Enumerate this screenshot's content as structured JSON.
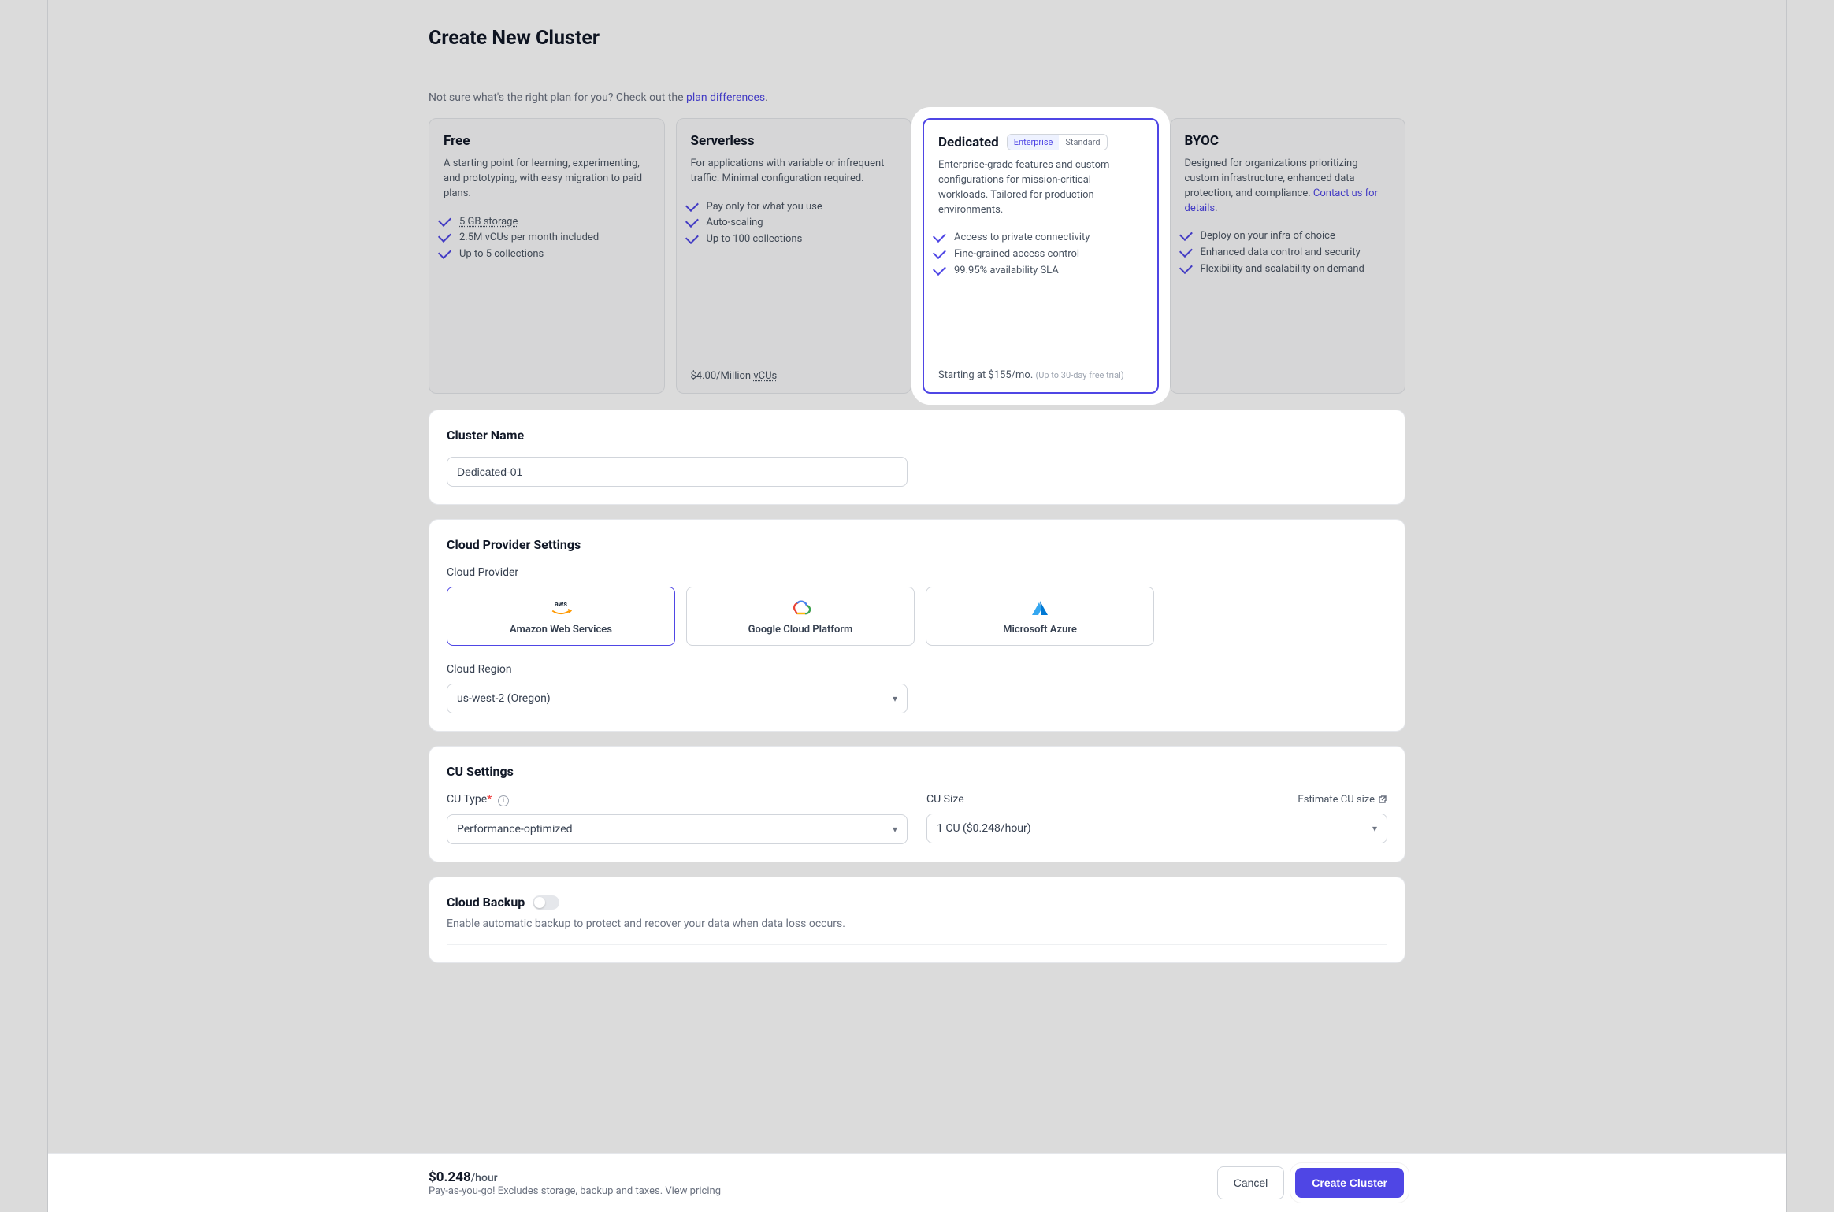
{
  "page": {
    "title": "Create New Cluster",
    "subhead_prefix": "Not sure what's the right plan for you? Check out the ",
    "subhead_link": "plan differences",
    "subhead_suffix": "."
  },
  "plans": {
    "free": {
      "title": "Free",
      "desc": "A starting point for learning, experimenting, and prototyping, with easy migration to paid plans.",
      "bullets": [
        "5 GB storage",
        "2.5M vCUs per month included",
        "Up to 5 collections"
      ],
      "price": ""
    },
    "serverless": {
      "title": "Serverless",
      "desc": "For applications with variable or infrequent traffic. Minimal configuration required.",
      "bullets": [
        "Pay only for what you use",
        "Auto-scaling",
        "Up to 100 collections"
      ],
      "price": "$4.00/Million vCUs"
    },
    "dedicated": {
      "title": "Dedicated",
      "toggle_enterprise": "Enterprise",
      "toggle_standard": "Standard",
      "desc": "Enterprise-grade features and custom configurations for mission-critical workloads. Tailored for production environments.",
      "bullets": [
        "Access to private connectivity",
        "Fine-grained access control",
        "99.95% availability SLA"
      ],
      "price_main": "Starting at $155/mo. ",
      "price_note": "(Up to 30-day free trial)"
    },
    "byoc": {
      "title": "BYOC",
      "desc_prefix": "Designed for organizations prioritizing custom infrastructure, enhanced data protection, and compliance. ",
      "desc_link": "Contact us for details",
      "desc_suffix": ".",
      "bullets": [
        "Deploy on your infra of choice",
        "Enhanced data control and security",
        "Flexibility and scalability on demand"
      ]
    }
  },
  "cluster_name": {
    "label": "Cluster Name",
    "value": "Dedicated-01"
  },
  "cloud": {
    "section_title": "Cloud Provider Settings",
    "provider_label": "Cloud Provider",
    "providers": {
      "aws": "Amazon Web Services",
      "gcp": "Google Cloud Platform",
      "azure": "Microsoft Azure"
    },
    "region_label": "Cloud Region",
    "region_value": "us-west-2 (Oregon)"
  },
  "cu": {
    "section_title": "CU Settings",
    "type_label": "CU Type",
    "type_value": "Performance-optimized",
    "size_label": "CU Size",
    "size_value": "1 CU ($0.248/hour)",
    "estimate_link": "Estimate CU size"
  },
  "backup": {
    "title": "Cloud Backup",
    "desc": "Enable automatic backup to protect and recover your data when data loss occurs."
  },
  "footer": {
    "price": "$0.248",
    "unit": "/hour",
    "note_prefix": "Pay-as-you-go! Excludes storage, backup and taxes. ",
    "note_link": "View pricing",
    "cancel": "Cancel",
    "create": "Create Cluster"
  }
}
